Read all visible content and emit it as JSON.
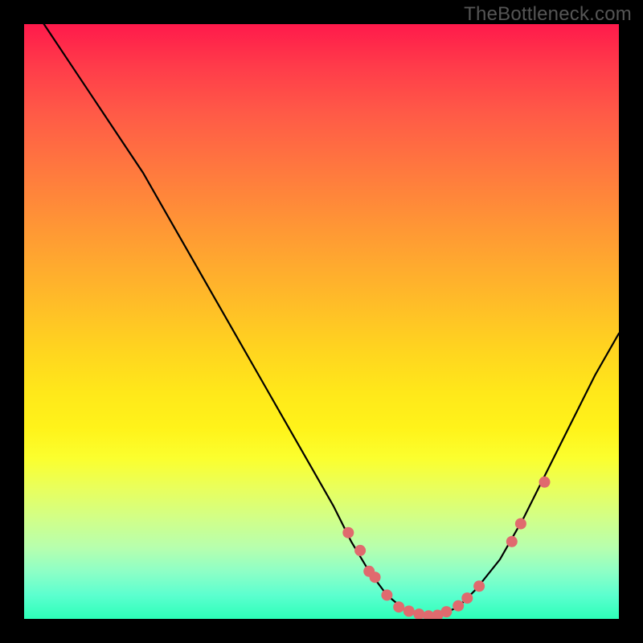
{
  "watermark": "TheBottleneck.com",
  "chart_data": {
    "type": "line",
    "title": "",
    "xlabel": "",
    "ylabel": "",
    "xlim": [
      0,
      100
    ],
    "ylim": [
      0,
      100
    ],
    "grid": false,
    "curve": {
      "x": [
        0,
        4,
        8,
        12,
        16,
        20,
        24,
        28,
        32,
        36,
        40,
        44,
        48,
        52,
        55,
        58,
        61,
        64,
        67,
        70,
        73,
        76,
        80,
        84,
        88,
        92,
        96,
        100
      ],
      "y": [
        105,
        99,
        93,
        87,
        81,
        75,
        68,
        61,
        54,
        47,
        40,
        33,
        26,
        19,
        13,
        8,
        4,
        1.5,
        0.5,
        0.7,
        2,
        5,
        10,
        17,
        25,
        33,
        41,
        48
      ]
    },
    "series": [
      {
        "name": "markers",
        "x": [
          54.5,
          56.5,
          58,
          59,
          61,
          63,
          64.7,
          66.4,
          68,
          69.5,
          71,
          73,
          74.5,
          76.5,
          82,
          83.5,
          87.5
        ],
        "y": [
          14.5,
          11.5,
          8,
          7,
          4,
          2,
          1.3,
          0.8,
          0.5,
          0.6,
          1.2,
          2.2,
          3.5,
          5.5,
          13,
          16,
          23
        ]
      }
    ]
  },
  "colors": {
    "dot": "#e06a6e",
    "curve": "#000000",
    "background_top": "#ff1a4b",
    "background_bottom": "#2dffb8"
  }
}
